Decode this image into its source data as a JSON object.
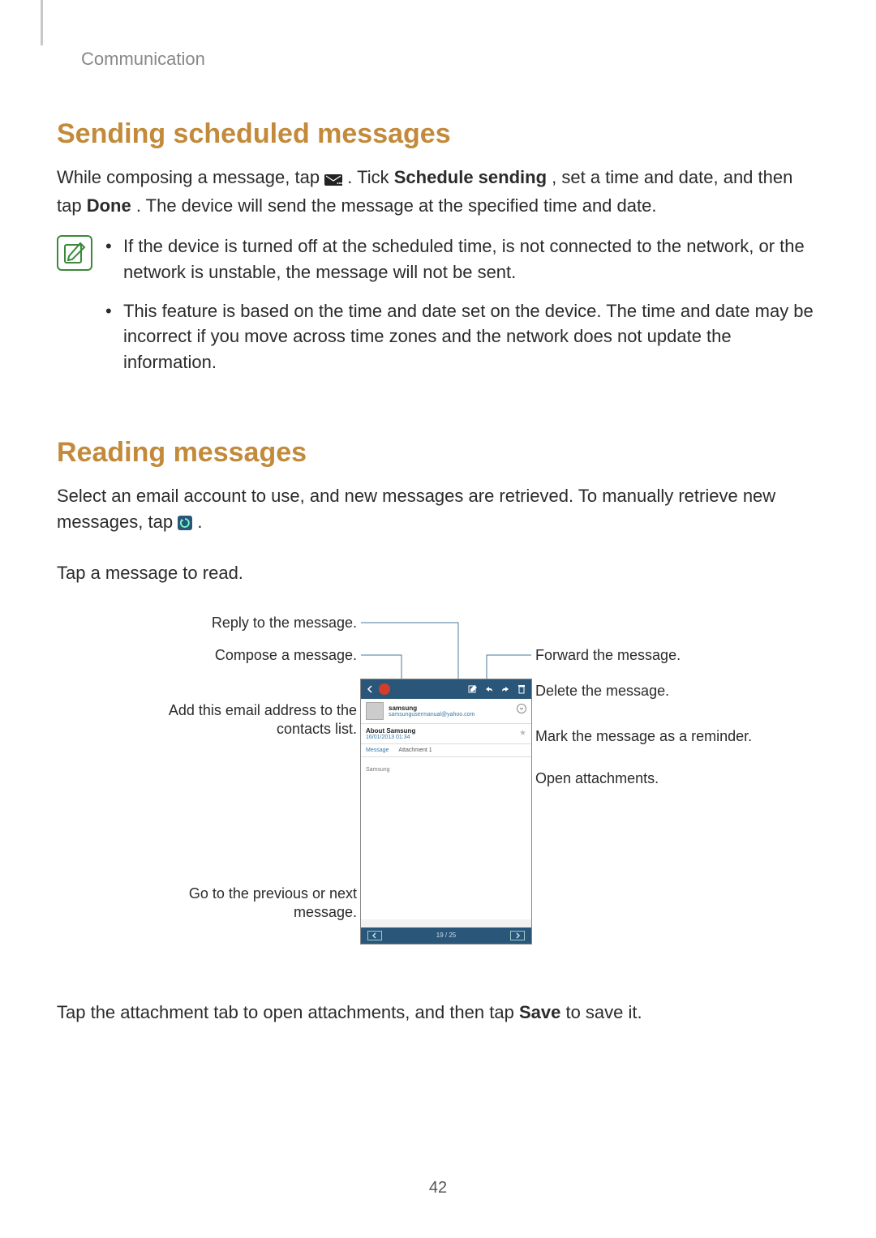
{
  "header": {
    "running": "Communication"
  },
  "section1": {
    "title": "Sending scheduled messages",
    "para_a": "While composing a message, tap ",
    "para_b": ". Tick ",
    "schedule_bold": "Schedule sending",
    "para_c": ", set a time and date, and then tap ",
    "done_bold": "Done",
    "para_d": ". The device will send the message at the specified time and date.",
    "bullet1": "If the device is turned off at the scheduled time, is not connected to the network, or the network is unstable, the message will not be sent.",
    "bullet2": "This feature is based on the time and date set on the device. The time and date may be incorrect if you move across time zones and the network does not update the information."
  },
  "section2": {
    "title": "Reading messages",
    "para_a": "Select an email account to use, and new messages are retrieved. To manually retrieve new messages, tap ",
    "para_b": ".",
    "para2": "Tap a message to read.",
    "after_a": "Tap the attachment tab to open attachments, and then tap ",
    "save_bold": "Save",
    "after_b": " to save it."
  },
  "callouts": {
    "reply": "Reply to the message.",
    "compose": "Compose a message.",
    "add_contact": "Add this email address to the contacts list.",
    "forward": "Forward the message.",
    "delete": "Delete the message.",
    "reminder": "Mark the message as a reminder.",
    "open_attachments": "Open attachments.",
    "prev_next": "Go to the previous or next message."
  },
  "phone": {
    "sender_name": "samsung",
    "sender_email": "samsungusermanual@yahoo.com",
    "subject": "About Samsung",
    "date": "16/01/2013  01:34",
    "tab_message": "Message",
    "tab_attachment": "Attachment 1",
    "body_preview": "Samsung",
    "footer_count": "19 / 25"
  },
  "page_number": "42"
}
